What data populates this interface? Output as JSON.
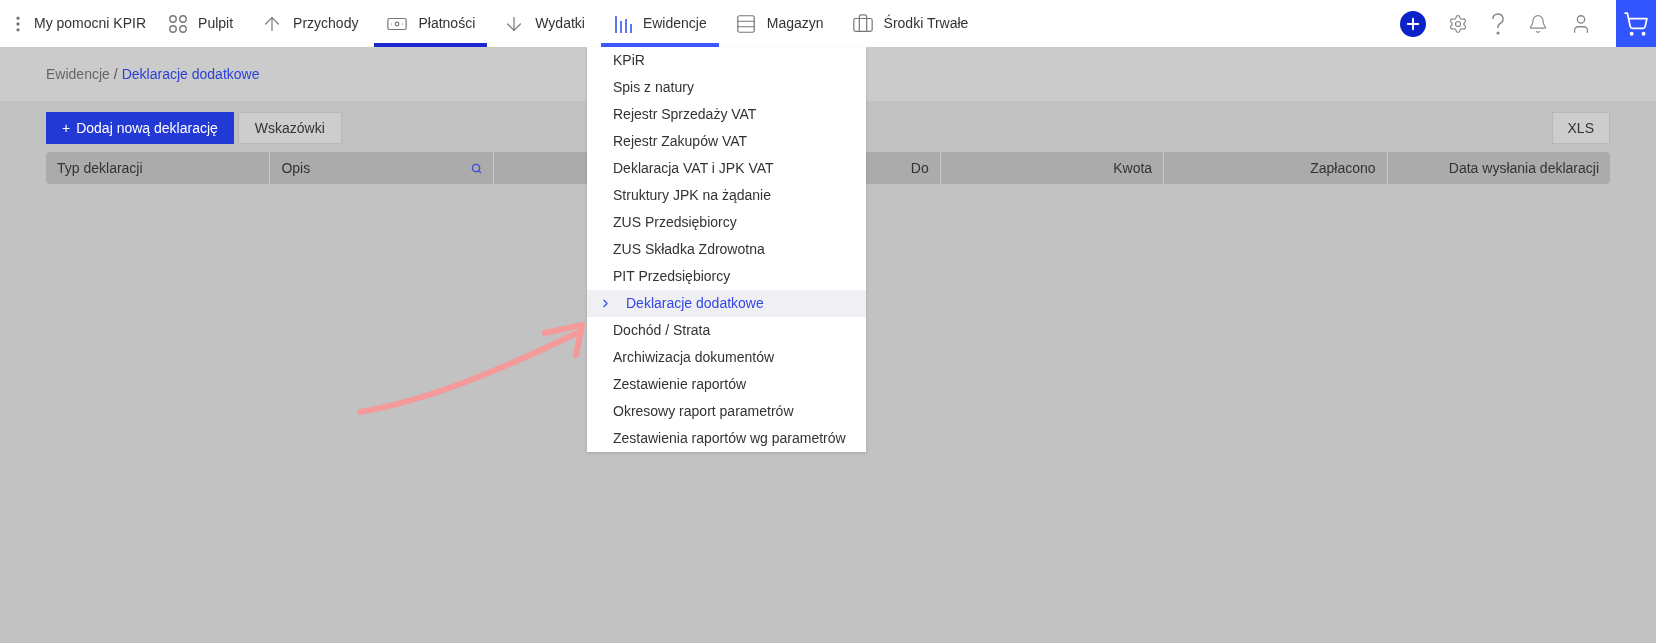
{
  "app_title": "My pomocni KPIR",
  "nav": [
    {
      "label": "Pulpit",
      "selected": false,
      "open": false
    },
    {
      "label": "Przychody",
      "selected": false,
      "open": false
    },
    {
      "label": "Płatności",
      "selected": true,
      "open": false
    },
    {
      "label": "Wydatki",
      "selected": false,
      "open": false
    },
    {
      "label": "Ewidencje",
      "selected": false,
      "open": true
    },
    {
      "label": "Magazyn",
      "selected": false,
      "open": false
    },
    {
      "label": "Środki Trwałe",
      "selected": false,
      "open": false
    }
  ],
  "breadcrumb": {
    "parent": "Ewidencje",
    "separator": "/",
    "current": "Deklaracje dodatkowe"
  },
  "toolbar": {
    "add_button": "Dodaj nową deklarację",
    "add_icon": "+",
    "hints_button": "Wskazówki",
    "export_button": "XLS"
  },
  "table": {
    "columns": [
      {
        "label": "Typ deklaracji",
        "search": false
      },
      {
        "label": "Opis",
        "search": true
      },
      {
        "search": false
      },
      {
        "label": "Do",
        "search": false
      },
      {
        "label": "Kwota",
        "search": false
      },
      {
        "label": "Zapłacono",
        "search": false
      },
      {
        "label": "Data wysłania deklaracji",
        "search": false
      }
    ]
  },
  "dropdown": {
    "items": [
      {
        "label": "KPiR",
        "selected": false
      },
      {
        "label": "Spis z natury",
        "selected": false
      },
      {
        "label": "Rejestr Sprzedaży VAT",
        "selected": false
      },
      {
        "label": "Rejestr Zakupów VAT",
        "selected": false
      },
      {
        "label": "Deklaracja VAT i JPK VAT",
        "selected": false
      },
      {
        "label": "Struktury JPK na żądanie",
        "selected": false
      },
      {
        "label": "ZUS Przedsiębiorcy",
        "selected": false
      },
      {
        "label": "ZUS Składka Zdrowotna",
        "selected": false
      },
      {
        "label": "PIT Przedsiębiorcy",
        "selected": false
      },
      {
        "label": "Deklaracje dodatkowe",
        "selected": true
      },
      {
        "label": "Dochód / Strata",
        "selected": false
      },
      {
        "label": "Archiwizacja dokumentów",
        "selected": false
      },
      {
        "label": "Zestawienie raportów",
        "selected": false
      },
      {
        "label": "Okresowy raport parametrów",
        "selected": false
      },
      {
        "label": "Zestawienia raportów wg parametrów",
        "selected": false
      }
    ]
  }
}
